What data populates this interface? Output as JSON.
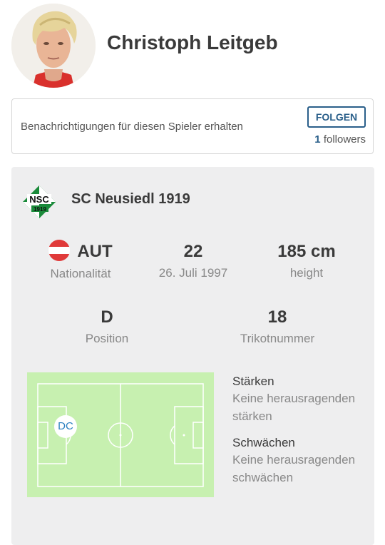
{
  "player": {
    "name": "Christoph Leitgeb",
    "avatar_icon": "player-photo"
  },
  "follow": {
    "text": "Benachrichtigungen für diesen Spieler erhalten",
    "button_label": "FOLGEN",
    "followers_count": "1",
    "followers_label": "followers"
  },
  "club": {
    "name": "SC Neusiedl 1919",
    "logo_icon": "club-crest-icon",
    "logo_text_top": "NSC",
    "logo_text_bottom": "1919"
  },
  "stats": {
    "nationality": {
      "value": "AUT",
      "label": "Nationalität",
      "flag_icon": "austria-flag-icon"
    },
    "age": {
      "value": "22",
      "label": "26. Juli 1997"
    },
    "height": {
      "value": "185 cm",
      "label": "height"
    },
    "position": {
      "value": "D",
      "label": "Position"
    },
    "shirt": {
      "value": "18",
      "label": "Trikotnummer"
    }
  },
  "pitch": {
    "position_badge": "DC"
  },
  "strengths": {
    "title": "Stärken",
    "text": "Keine herausragenden stärken"
  },
  "weaknesses": {
    "title": "Schwächen",
    "text": "Keine herausragenden schwächen"
  },
  "colors": {
    "accent": "#2a5f8a",
    "card_bg": "#eeeeef",
    "pitch_green": "#c7f0b0",
    "badge_text": "#2a7fc0"
  }
}
